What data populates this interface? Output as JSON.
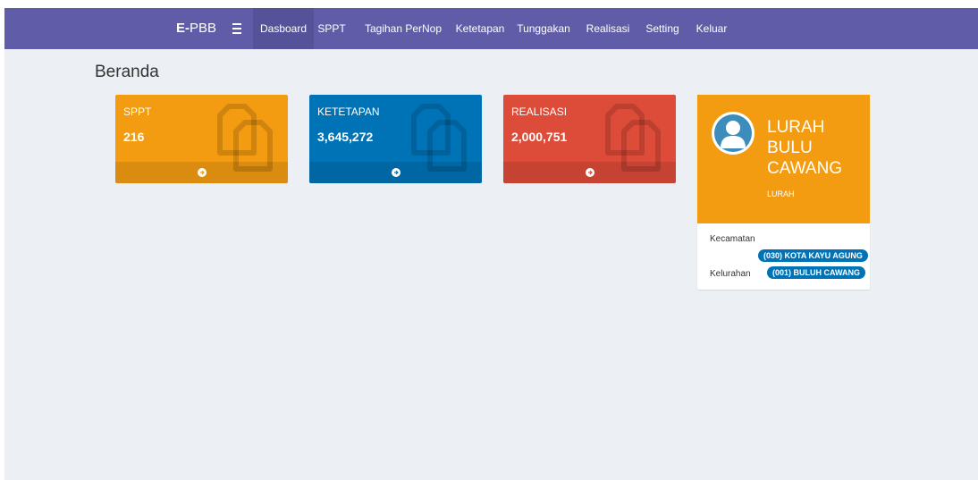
{
  "navbar": {
    "brand_bold": "E-",
    "brand_rest": "PBB",
    "items": [
      {
        "label": "Dasboard"
      },
      {
        "label": "SPPT"
      },
      {
        "label": "Tagihan PerNop"
      },
      {
        "label": "Ketetapan"
      },
      {
        "label": "Tunggakan"
      },
      {
        "label": "Realisasi"
      },
      {
        "label": "Setting"
      },
      {
        "label": "Keluar"
      }
    ],
    "active_item": "Dasboard"
  },
  "page": {
    "title": "Beranda"
  },
  "boxes": [
    {
      "label": "SPPT",
      "value": "216",
      "color": "#f39c12",
      "icon": "files-icon"
    },
    {
      "label": "KETETAPAN",
      "value": "3,645,272",
      "color": "#0073b7",
      "icon": "files-icon"
    },
    {
      "label": "REALISASI",
      "value": "2,000,751",
      "color": "#dd4b39",
      "icon": "files-icon"
    }
  ],
  "profile": {
    "name_lines": [
      "LURAH",
      "BULU",
      "CAWANG"
    ],
    "role": "LURAH",
    "header_color": "#f39c12",
    "kecamatan_label": "Kecamatan",
    "kecamatan_value": "(030) KOTA KAYU AGUNG",
    "kelurahan_label": "Kelurahan",
    "kelurahan_value": "(001) BULUH CAWANG"
  },
  "colors": {
    "navbar": "#605ca8",
    "navbar_active": "#555299",
    "background": "#ecf0f5",
    "badge": "#0073b7"
  }
}
